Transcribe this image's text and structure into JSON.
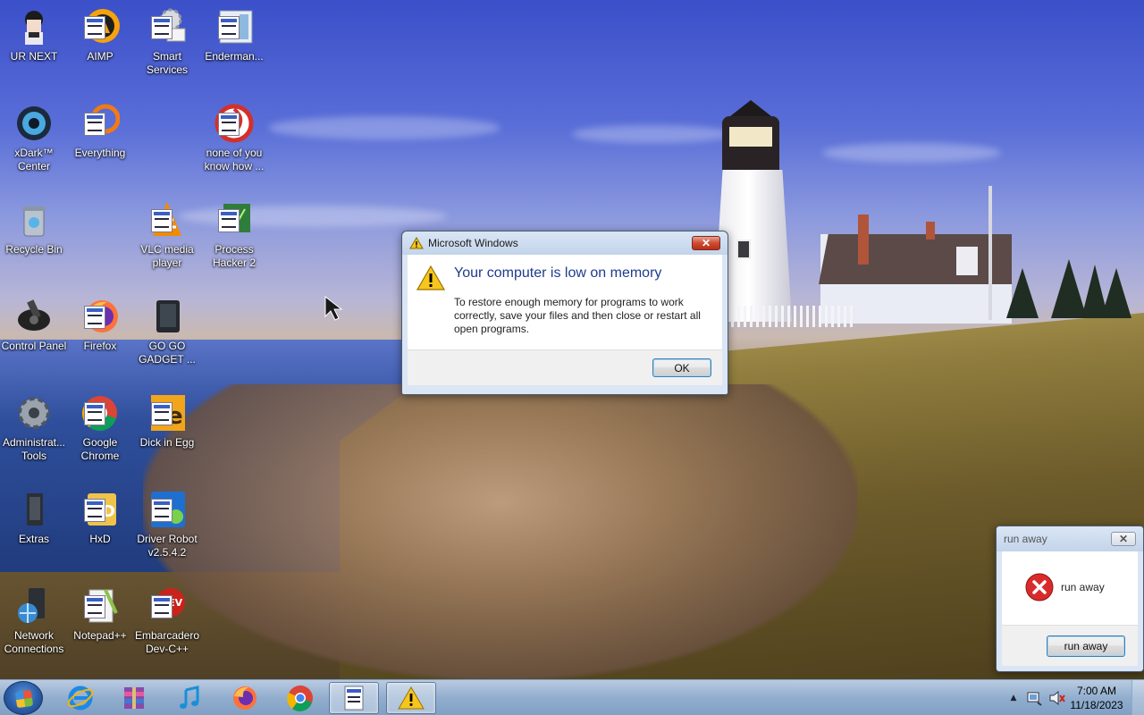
{
  "desktop": {
    "icons": [
      {
        "label": "UR NEXT"
      },
      {
        "label": "AIMP"
      },
      {
        "label": "Smart Services"
      },
      {
        "label": "Enderman..."
      },
      {
        "label": "xDark™ Center"
      },
      {
        "label": "Everything"
      },
      {
        "label": "none of you know how ..."
      },
      {
        "label": "Recycle Bin"
      },
      {
        "label": "VLC media player"
      },
      {
        "label": "Process Hacker 2"
      },
      {
        "label": "Control Panel"
      },
      {
        "label": "Firefox"
      },
      {
        "label": "GO GO GADGET ..."
      },
      {
        "label": "Administrat... Tools"
      },
      {
        "label": "Google Chrome"
      },
      {
        "label": "Dick in Egg"
      },
      {
        "label": "Extras"
      },
      {
        "label": "HxD"
      },
      {
        "label": "Driver Robot v2.5.4.2"
      },
      {
        "label": "Network Connections"
      },
      {
        "label": "Notepad++"
      },
      {
        "label": "Embarcadero Dev-C++"
      }
    ]
  },
  "memory_dialog": {
    "title": "Microsoft Windows",
    "heading": "Your computer is low on memory",
    "body": "To restore enough memory for programs to work correctly, save your files and then close or restart all open programs.",
    "ok_label": "OK",
    "close_glyph": "✕",
    "icon": "warning-icon"
  },
  "runaway_dialog": {
    "title": "run away",
    "message": "run away",
    "button_label": "run away",
    "close_glyph": "✕",
    "icon": "error-icon"
  },
  "taskbar": {
    "pinned": [
      "internet-explorer-icon",
      "winrar-icon",
      "itunes-icon",
      "firefox-icon",
      "chrome-icon",
      "app-window-icon",
      "warning-icon"
    ],
    "clock": {
      "time": "7:00 AM",
      "date": "11/18/2023"
    },
    "tray_expand_glyph": "▲"
  },
  "colors": {
    "title_text": "#1a1a1a",
    "heading_blue": "#1e3c8c",
    "close_red": "#cf4a33"
  }
}
